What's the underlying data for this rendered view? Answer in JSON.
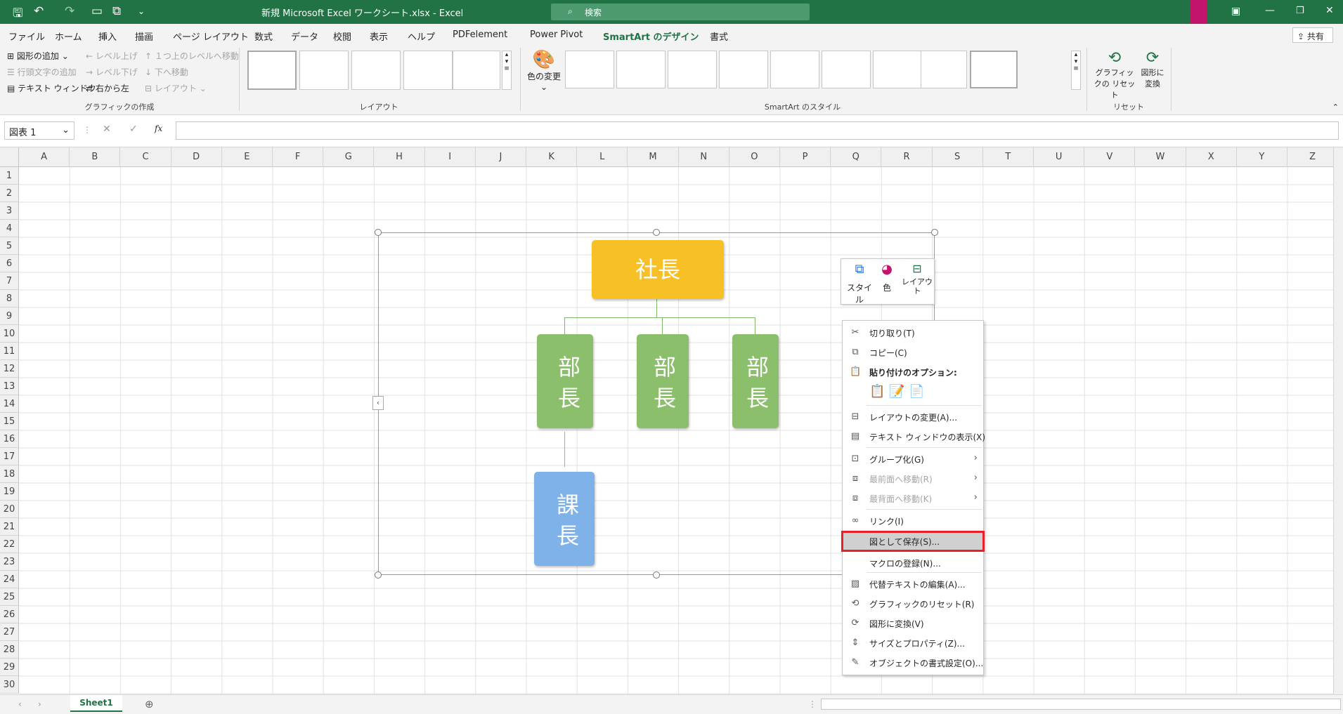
{
  "window": {
    "title": "新規 Microsoft Excel ワークシート.xlsx  -  Excel",
    "search": "検索"
  },
  "tabs": [
    "ファイル",
    "ホーム",
    "挿入",
    "描画",
    "ページ レイアウト",
    "数式",
    "データ",
    "校閲",
    "表示",
    "ヘルプ",
    "PDFelement",
    "Power Pivot",
    "SmartArt のデザイン",
    "書式"
  ],
  "share": "共有",
  "ribbon": {
    "create": {
      "add_shape": "図形の追加",
      "add_bullet": "行頭文字の追加",
      "text_pane": "テキスト ウィンドウ",
      "promote": "レベル上げ",
      "demote": "レベル下げ",
      "right_to_left": "右から左",
      "move_up": "１つ上のレベルへ移動",
      "move_down": "下へ移動",
      "layout": "レイアウト",
      "group": "グラフィックの作成"
    },
    "layouts_group": "レイアウト",
    "change_colors": "色の変更",
    "styles_group": "SmartArt のスタイル",
    "reset_graphic": "グラフィックの リセット",
    "convert_shapes": "図形に 変換",
    "reset_group": "リセット"
  },
  "formula": {
    "namebox": "図表 1",
    "fx": "fx",
    "value": ""
  },
  "columns": [
    "A",
    "B",
    "C",
    "D",
    "E",
    "F",
    "G",
    "H",
    "I",
    "J",
    "K",
    "L",
    "M",
    "N",
    "O",
    "P",
    "Q",
    "R",
    "S",
    "T",
    "U",
    "V",
    "W",
    "X",
    "Y",
    "Z"
  ],
  "rows": [
    "1",
    "2",
    "3",
    "4",
    "5",
    "6",
    "7",
    "8",
    "9",
    "10",
    "11",
    "12",
    "13",
    "14",
    "15",
    "16",
    "17",
    "18",
    "19",
    "20",
    "21",
    "22",
    "23",
    "24",
    "25",
    "26",
    "27",
    "28",
    "29",
    "30"
  ],
  "smartart": {
    "ceo": "社長",
    "manager": "部長",
    "manager2": "部長",
    "manager3": "部長",
    "section": "課長",
    "top_color": "#f6c026",
    "mid_color": "#8bbf6b",
    "bottom_color": "#7fb2e8"
  },
  "minibar": {
    "style": "スタイル",
    "color": "色",
    "layout": "レイアウト"
  },
  "context_menu": {
    "cut": "切り取り(T)",
    "copy": "コピー(C)",
    "paste_options": "貼り付けのオプション:",
    "change_layout": "レイアウトの変更(A)...",
    "text_pane": "テキスト ウィンドウの表示(X)",
    "group": "グループ化(G)",
    "bring_front": "最前面へ移動(R)",
    "send_back": "最背面へ移動(K)",
    "link": "リンク(I)",
    "save_as_picture": "図として保存(S)...",
    "assign_macro": "マクロの登録(N)...",
    "alt_text": "代替テキストの編集(A)...",
    "reset_graphic": "グラフィックのリセット(R)",
    "convert_to_shapes": "図形に変換(V)",
    "size_properties": "サイズとプロパティ(Z)...",
    "format_object": "オブジェクトの書式設定(O)..."
  },
  "sheet": {
    "tab": "Sheet1"
  },
  "accent": "#217346"
}
